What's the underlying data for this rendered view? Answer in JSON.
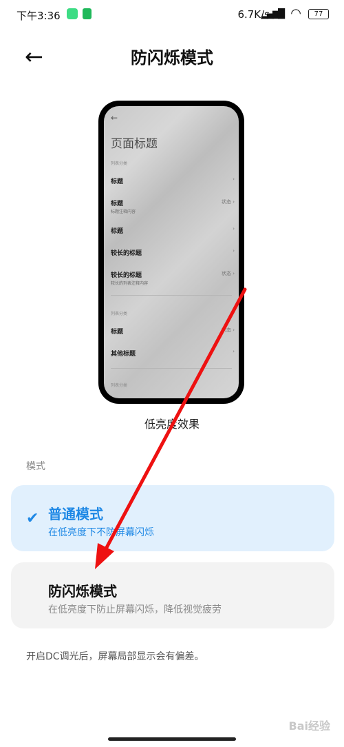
{
  "status_bar": {
    "time": "下午3:36",
    "network_speed": "6.7K/s",
    "signal": "HD",
    "battery": "77"
  },
  "header": {
    "title": "防闪烁模式"
  },
  "preview": {
    "back": "←",
    "page_title": "页面标题",
    "section1": "列表分类",
    "rows": [
      {
        "title": "标题",
        "sub": "",
        "status": ""
      },
      {
        "title": "标题",
        "sub": "标题注释内容",
        "status": "状态"
      },
      {
        "title": "标题",
        "sub": "",
        "status": ""
      },
      {
        "title": "较长的标题",
        "sub": "",
        "status": ""
      },
      {
        "title": "较长的标题",
        "sub": "较长的列表注释内容",
        "status": "状态"
      }
    ],
    "section2": "列表分类",
    "rows2": [
      {
        "title": "标题",
        "status": "状态"
      },
      {
        "title": "其他标题",
        "status": ""
      }
    ],
    "section3": "列表分类",
    "caption": "低亮度效果"
  },
  "mode_section": {
    "label": "模式",
    "options": [
      {
        "title": "普通模式",
        "subtitle": "在低亮度下不防屏幕闪烁",
        "selected": true
      },
      {
        "title": "防闪烁模式",
        "subtitle": "在低亮度下防止屏幕闪烁，降低视觉疲劳",
        "selected": false
      }
    ]
  },
  "note": "开启DC调光后，屏幕局部显示会有偏差。",
  "watermark": "Bai经验",
  "colors": {
    "accent": "#1e88e5",
    "annotation_arrow": "#ee1111"
  }
}
